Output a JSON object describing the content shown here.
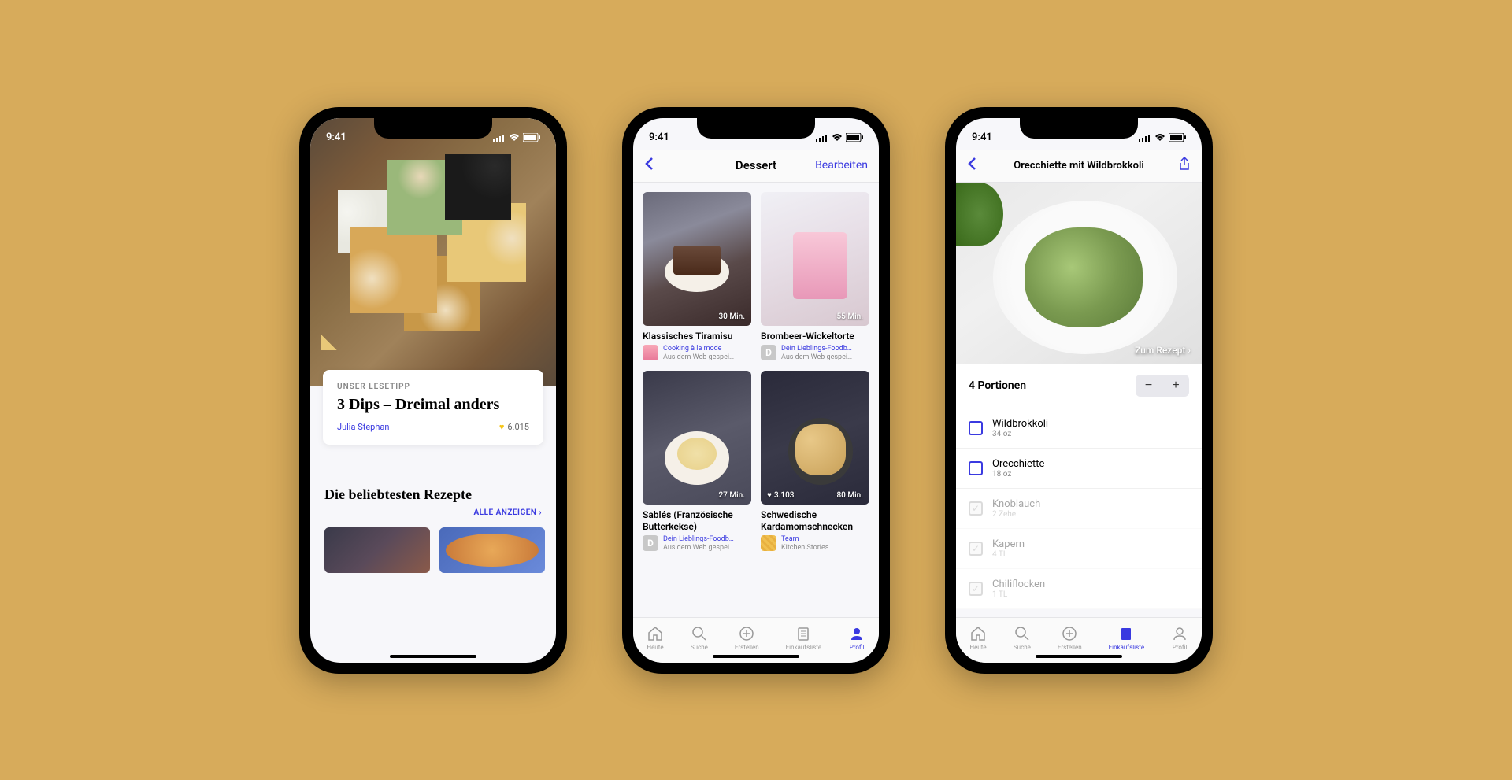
{
  "status": {
    "time": "9:41"
  },
  "tabs": {
    "heute": "Heute",
    "suche": "Suche",
    "erstellen": "Erstellen",
    "einkaufsliste": "Einkaufsliste",
    "profil": "Profil"
  },
  "phone1": {
    "card": {
      "eyebrow": "UNSER LESETIPP",
      "title": "3 Dips – Dreimal anders",
      "author": "Julia Stephan",
      "likes": "6.015"
    },
    "section_title": "Die beliebtesten Rezepte",
    "section_link": "ALLE ANZEIGEN ›"
  },
  "phone2": {
    "nav": {
      "title": "Dessert",
      "edit": "Bearbeiten"
    },
    "items": [
      {
        "time": "30 Min.",
        "title": "Klassisches Tiramisu",
        "src": "Cooking à la mode",
        "sub": "Aus dem Web gespei…",
        "icon": "pink"
      },
      {
        "time": "55 Min.",
        "title": "Brombeer-Wickeltorte",
        "src": "Dein Lieblings-Foodb…",
        "sub": "Aus dem Web gespei…",
        "icon": "gray"
      },
      {
        "time": "27 Min.",
        "title": "Sablés (Französische Butterkekse)",
        "src": "Dein Lieblings-Foodb…",
        "sub": "Aus dem Web gespei…",
        "icon": "gray"
      },
      {
        "time": "80 Min.",
        "likes": "3.103",
        "title": "Schwedische Kardamomschnecken",
        "src": "Team",
        "sub": "Kitchen Stories",
        "icon": "yellow"
      }
    ]
  },
  "phone3": {
    "nav": {
      "title": "Orecchiette mit Wildbrokkoli"
    },
    "to_recipe": "Zum Rezept ›",
    "portions_label": "4 Portionen",
    "ingredients": [
      {
        "name": "Wildbrokkoli",
        "amt": "34 oz",
        "checked": false
      },
      {
        "name": "Orecchiette",
        "amt": "18 oz",
        "checked": false
      },
      {
        "name": "Knoblauch",
        "amt": "2 Zehe",
        "checked": true
      },
      {
        "name": "Kapern",
        "amt": "4 TL",
        "checked": true
      },
      {
        "name": "Chiliflocken",
        "amt": "1 TL",
        "checked": true
      }
    ]
  }
}
